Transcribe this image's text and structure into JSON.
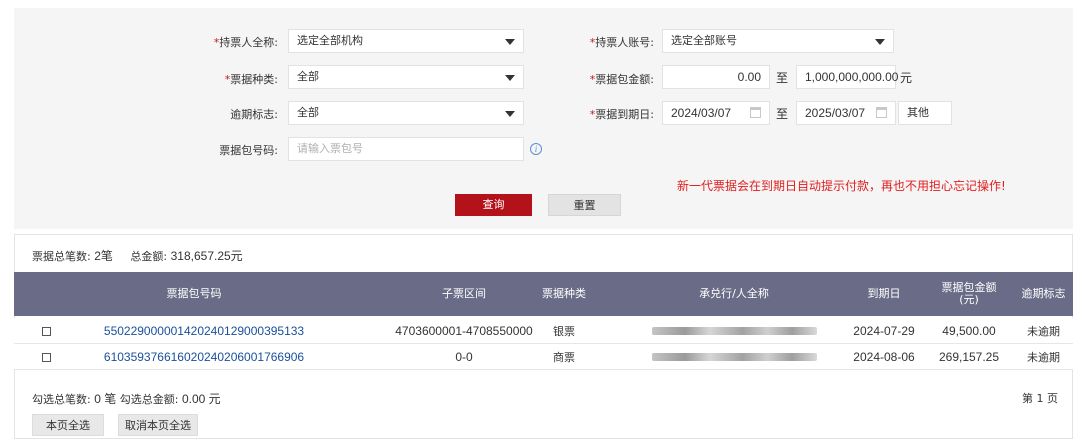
{
  "form": {
    "holder_name": {
      "label": "持票人全称:",
      "value": "选定全部机构"
    },
    "holder_account": {
      "label": "持票人账号:",
      "value": "选定全部账号"
    },
    "bill_type": {
      "label": "票据种类:",
      "value": "全部"
    },
    "amount": {
      "label": "票据包金额:",
      "min": "0.00",
      "to": "至",
      "max": "1,000,000,000.00",
      "unit": "元"
    },
    "overdue": {
      "label": "逾期标志:",
      "value": "全部"
    },
    "due_date": {
      "label": "票据到期日:",
      "start": "2024/03/07",
      "to": "至",
      "end": "2025/03/07",
      "other": "其他"
    },
    "package_no": {
      "label": "票据包号码:",
      "placeholder": "请输入票包号"
    },
    "required_mark": "*",
    "notice": "新一代票据会在到期日自动提示付款，再也不用担心忘记操作!",
    "query_btn": "查询",
    "reset_btn": "重置"
  },
  "summary": {
    "count_label": "票据总笔数:",
    "count": "2笔",
    "amount_label": "总金额:",
    "amount": "318,657.25元"
  },
  "table": {
    "headers": [
      "票据包号码",
      "子票区间",
      "票据种类",
      "承兑行/人全称",
      "到期日",
      "票据包金额\n(元)",
      "逾期标志"
    ],
    "rows": [
      {
        "package_no": "550229000001420240129000395133",
        "range": "4703600001-4708550000",
        "type": "银票",
        "due": "2024-07-29",
        "amount": "49,500.00",
        "overdue": "未逾期"
      },
      {
        "package_no": "610359376616020240206001766906",
        "range": "0-0",
        "type": "商票",
        "due": "2024-08-06",
        "amount": "269,157.25",
        "overdue": "未逾期"
      }
    ]
  },
  "footer": {
    "selected_label": "勾选总笔数:",
    "selected_count": "0 笔",
    "selected_amount_label": "勾选总金额:",
    "selected_amount": "0.00 元",
    "page": "第 1 页",
    "select_all": "本页全选",
    "cancel_all": "取消本页全选"
  },
  "icons": {
    "dropdown": "caret-down-icon",
    "calendar": "calendar-icon",
    "info": "info-icon",
    "checkbox": "checkbox-icon"
  },
  "colors": {
    "primary": "#b3121b",
    "header_bg": "#6a6c87",
    "link": "#1a4f9a",
    "notice": "#e02020"
  }
}
